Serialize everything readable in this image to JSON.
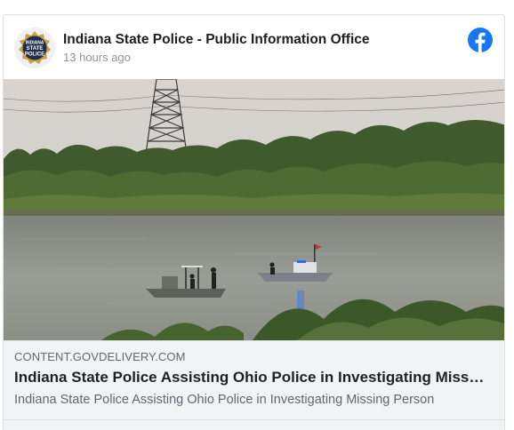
{
  "post": {
    "page_name": "Indiana State Police - Public Information Office",
    "timestamp": "13 hours ago",
    "avatar_text": [
      "INDIANA",
      "STATE",
      "POLICE"
    ],
    "logo_icon": "facebook-icon"
  },
  "link_preview": {
    "domain": "CONTENT.GOVDELIVERY.COM",
    "title": "Indiana State Police Assisting Ohio Police in Investigating Missing Person",
    "description": "Indiana State Police Assisting Ohio Police in Investigating Missing Person"
  },
  "colors": {
    "facebook_blue": "#1877f2",
    "badge_navy": "#1f2d4f",
    "badge_gold": "#c9a23a",
    "river": "#8a8f86"
  }
}
